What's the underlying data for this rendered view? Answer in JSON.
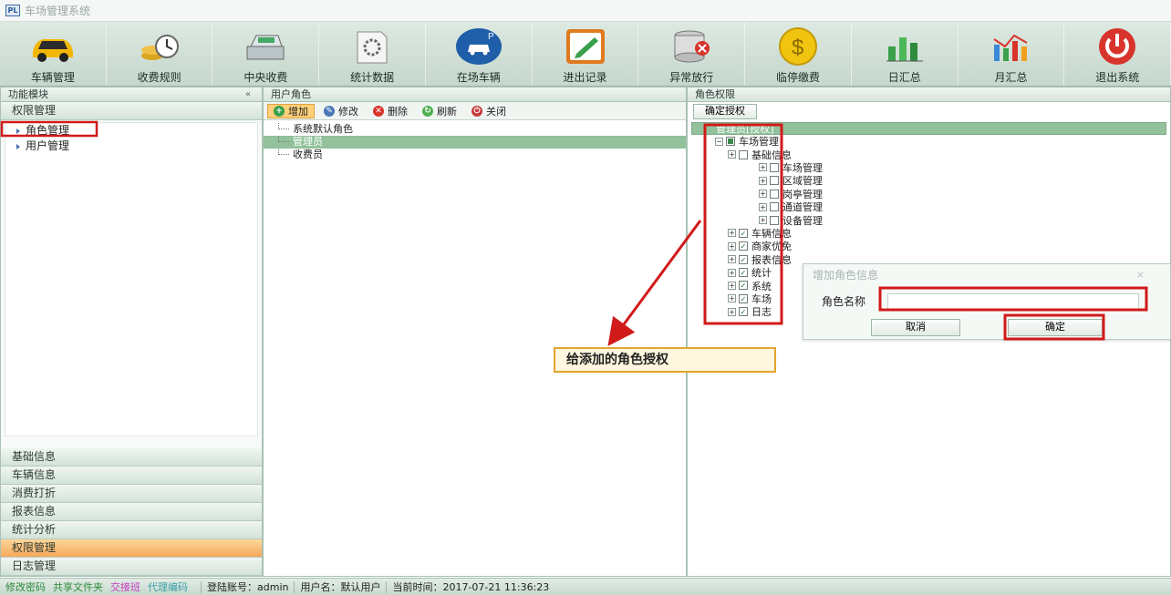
{
  "app": {
    "title": "车场管理系统",
    "icon_text": "PL"
  },
  "toolbar": {
    "items": [
      {
        "label": "车辆管理",
        "icon": "car-icon"
      },
      {
        "label": "收费规则",
        "icon": "coins-clock-icon"
      },
      {
        "label": "中央收费",
        "icon": "cash-register-icon"
      },
      {
        "label": "统计数据",
        "icon": "report-gear-icon"
      },
      {
        "label": "在场车辆",
        "icon": "parked-car-icon"
      },
      {
        "label": "进出记录",
        "icon": "edit-record-icon"
      },
      {
        "label": "异常放行",
        "icon": "database-error-icon"
      },
      {
        "label": "临停缴费",
        "icon": "dollar-coin-icon"
      },
      {
        "label": "日汇总",
        "icon": "bar-chart-icon"
      },
      {
        "label": "月汇总",
        "icon": "line-chart-icon"
      },
      {
        "label": "退出系统",
        "icon": "power-icon"
      }
    ]
  },
  "left": {
    "title": "功能模块",
    "collapse_glyph": "«",
    "active_group": "权限管理",
    "tree": [
      "角色管理",
      "用户管理"
    ],
    "groups_bottom": [
      {
        "label": "基础信息",
        "active": false
      },
      {
        "label": "车辆信息",
        "active": false
      },
      {
        "label": "消费打折",
        "active": false
      },
      {
        "label": "报表信息",
        "active": false
      },
      {
        "label": "统计分析",
        "active": false
      },
      {
        "label": "权限管理",
        "active": true
      },
      {
        "label": "日志管理",
        "active": false
      }
    ]
  },
  "middle": {
    "title": "用户角色",
    "actions": [
      {
        "label": "增加",
        "color": "#3aa04a",
        "glyph": "+"
      },
      {
        "label": "修改",
        "color": "#4a78b8",
        "glyph": "✎"
      },
      {
        "label": "删除",
        "color": "#d8342c",
        "glyph": "✕"
      },
      {
        "label": "刷新",
        "color": "#4fae4f",
        "glyph": "↻"
      },
      {
        "label": "关闭",
        "color": "#c43a3a",
        "glyph": "⏻"
      }
    ],
    "roles": [
      {
        "label": "系统默认角色",
        "selected": false
      },
      {
        "label": "管理员",
        "selected": true
      },
      {
        "label": "收费员",
        "selected": false
      }
    ]
  },
  "right": {
    "title": "角色权限",
    "confirm_label": "确定授权",
    "root_label": "管理员[授权]",
    "tree": [
      {
        "label": "车场管理",
        "level": 0,
        "check": "partial"
      },
      {
        "label": "基础信息",
        "level": 1,
        "check": "none"
      },
      {
        "label": "车场管理",
        "level": 2,
        "check": "none"
      },
      {
        "label": "区域管理",
        "level": 2,
        "check": "none"
      },
      {
        "label": "岗亭管理",
        "level": 2,
        "check": "none"
      },
      {
        "label": "通道管理",
        "level": 2,
        "check": "none"
      },
      {
        "label": "设备管理",
        "level": 2,
        "check": "none"
      },
      {
        "label": "车辆信息",
        "level": 1,
        "check": "checked"
      },
      {
        "label": "商家优免",
        "level": 1,
        "check": "checked"
      },
      {
        "label": "报表信息",
        "level": 1,
        "check": "checked"
      },
      {
        "label": "统计",
        "level": 1,
        "check": "checked"
      },
      {
        "label": "系统",
        "level": 1,
        "check": "checked"
      },
      {
        "label": "车场",
        "level": 1,
        "check": "checked"
      },
      {
        "label": "日志",
        "level": 1,
        "check": "checked"
      }
    ]
  },
  "dialog": {
    "title": "增加角色信息",
    "close_glyph": "×",
    "field_label": "角色名称",
    "field_value": "",
    "cancel_label": "取消",
    "ok_label": "确定"
  },
  "callout": {
    "text": "给添加的角色授权"
  },
  "status": {
    "links": [
      {
        "label": "修改密码",
        "color": "#2d8a3a"
      },
      {
        "label": "共享文件夹",
        "color": "#2d8a3a"
      },
      {
        "label": "交接班",
        "color": "#c43ac0"
      },
      {
        "label": "代理编码",
        "color": "#3aa0a8"
      }
    ],
    "account": "登陆账号：admin",
    "username": "用户名：默认用户",
    "time": "当前时间：2017-07-21 11:36:23"
  },
  "colors": {
    "annotation_red": "#d11a1a",
    "callout_border": "#e2a52e",
    "selection_green": "#92c19b"
  }
}
